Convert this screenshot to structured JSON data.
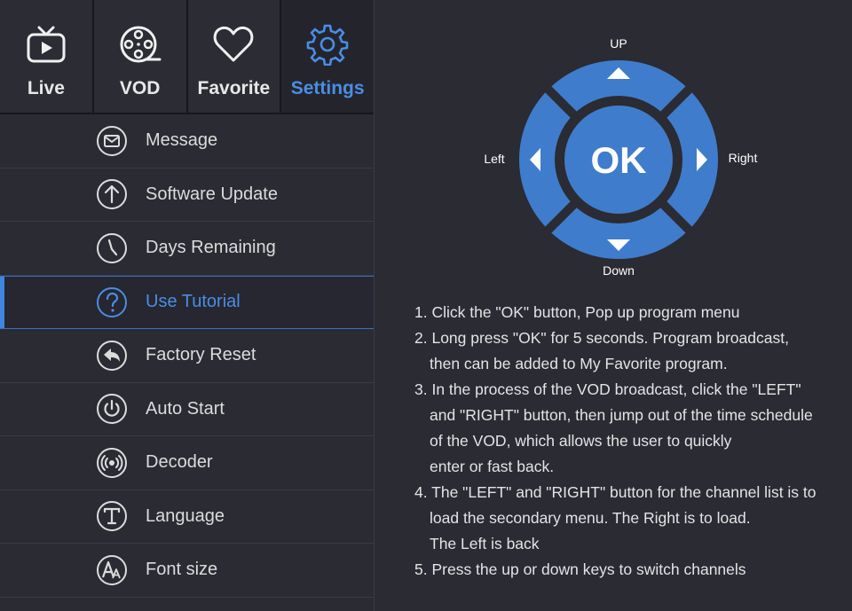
{
  "tabs": [
    {
      "label": "Live",
      "icon": "tv-icon"
    },
    {
      "label": "VOD",
      "icon": "film-reel-icon"
    },
    {
      "label": "Favorite",
      "icon": "heart-icon"
    },
    {
      "label": "Settings",
      "icon": "gear-icon",
      "active": true
    }
  ],
  "menu": [
    {
      "label": "Message",
      "icon": "envelope-icon"
    },
    {
      "label": "Software Update",
      "icon": "arrow-up-icon"
    },
    {
      "label": "Days Remaining",
      "icon": "clock-icon"
    },
    {
      "label": "Use Tutorial",
      "icon": "question-icon",
      "active": true
    },
    {
      "label": "Factory Reset",
      "icon": "reply-arrow-icon"
    },
    {
      "label": "Auto Start",
      "icon": "power-icon"
    },
    {
      "label": "Decoder",
      "icon": "broadcast-icon"
    },
    {
      "label": "Language",
      "icon": "letter-t-icon"
    },
    {
      "label": "Font size",
      "icon": "font-size-icon"
    }
  ],
  "dpad": {
    "ok": "OK",
    "up": "UP",
    "down": "Down",
    "left": "Left",
    "right": "Right"
  },
  "instructions": [
    "1. Click the \"OK\" button, Pop up program menu",
    "2. Long press \"OK\" for 5 seconds. Program broadcast,\nthen can be added to My Favorite program.",
    "3. In the process of the VOD broadcast, click the \"LEFT\"\nand \"RIGHT\" button, then jump out of the time schedule\nof the VOD, which allows the user to quickly\n enter or fast back.",
    "4. The \"LEFT\" and \"RIGHT\" button for the channel list is to\nload the secondary menu. The Right is to load.\nThe Left is back",
    "5. Press the up or down keys to switch channels"
  ],
  "colors": {
    "accent": "#4a8de6",
    "dpad_blue": "#3f7ccc",
    "background": "#2a2b33"
  }
}
